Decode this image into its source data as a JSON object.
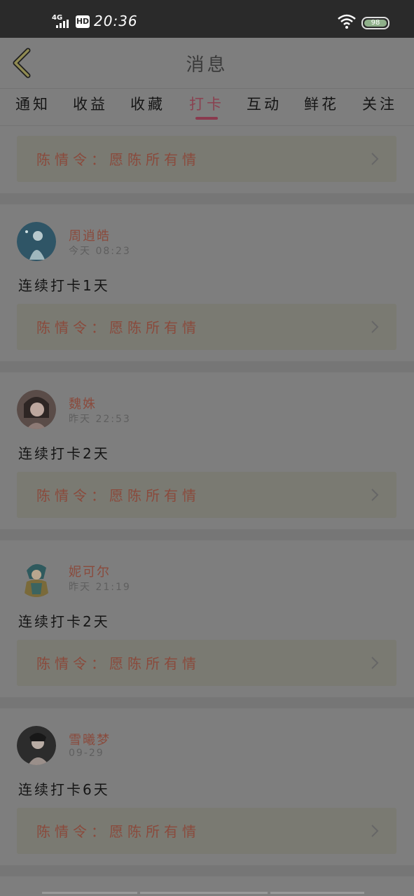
{
  "status_bar": {
    "network": "4G",
    "hd": "HD",
    "time": "20:36",
    "battery": "98"
  },
  "header": {
    "title": "消息"
  },
  "tabs": [
    {
      "label": "通知"
    },
    {
      "label": "收益"
    },
    {
      "label": "收藏"
    },
    {
      "label": "打卡"
    },
    {
      "label": "互动"
    },
    {
      "label": "鲜花"
    },
    {
      "label": "关注"
    }
  ],
  "active_tab": "打卡",
  "top_link": {
    "text": "陈情令：愿陈所有情"
  },
  "checkins": [
    {
      "name": "周逍皓",
      "time": "今天 08:23",
      "text": "连续打卡1天",
      "link": "陈情令：愿陈所有情",
      "avatar_color": "#3e6b7c"
    },
    {
      "name": "魏姝",
      "time": "昨天 22:53",
      "text": "连续打卡2天",
      "link": "陈情令：愿陈所有情",
      "avatar_color": "#6b5a55"
    },
    {
      "name": "妮可尔",
      "time": "昨天 21:19",
      "text": "连续打卡2天",
      "link": "陈情令：愿陈所有情",
      "avatar_color": "#4a6b6b"
    },
    {
      "name": "雪曦梦",
      "time": "09-29",
      "text": "连续打卡6天",
      "link": "陈情令：愿陈所有情",
      "avatar_color": "#3a3a3a"
    }
  ]
}
